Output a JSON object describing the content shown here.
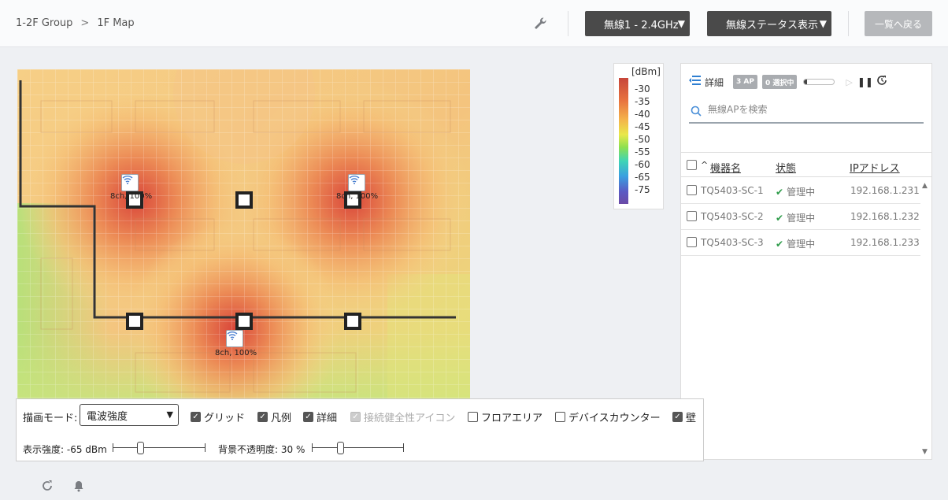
{
  "breadcrumb": {
    "group": "1-2F Group",
    "separator": ">",
    "current": "1F Map"
  },
  "header": {
    "band_select": "無線1 - 2.4GHz",
    "status_select": "無線ステータス表示",
    "back_button": "一覧へ戻る"
  },
  "map": {
    "access_points": [
      {
        "label": "8ch, 100%"
      },
      {
        "label": "8ch, 100%"
      },
      {
        "label": "8ch, 100%"
      }
    ]
  },
  "legend": {
    "unit": "[dBm]",
    "ticks": [
      "-30",
      "-35",
      "-40",
      "-45",
      "-50",
      "-55",
      "-60",
      "-65",
      "-75"
    ]
  },
  "panel": {
    "detail_label": "詳細",
    "ap_count_badge": "3 AP",
    "selected_badge": "0 選択中",
    "progress": 0.1,
    "search_placeholder": "無線APを検索",
    "columns": {
      "sort_indicator": "^",
      "name": "機器名",
      "status": "状態",
      "ip": "IPアドレス"
    },
    "rows": [
      {
        "name": "TQ5403-SC-1",
        "status": "管理中",
        "ip": "192.168.1.231"
      },
      {
        "name": "TQ5403-SC-2",
        "status": "管理中",
        "ip": "192.168.1.232"
      },
      {
        "name": "TQ5403-SC-3",
        "status": "管理中",
        "ip": "192.168.1.233"
      }
    ]
  },
  "controls": {
    "mode_label": "描画モード:",
    "mode_value": "電波強度",
    "grid": {
      "label": "グリッド",
      "checked": true
    },
    "legend_toggle": {
      "label": "凡例",
      "checked": true
    },
    "detail_toggle": {
      "label": "詳細",
      "checked": true
    },
    "health_icon": {
      "label": "接続健全性アイコン",
      "checked": true,
      "disabled": true
    },
    "floor_area": {
      "label": "フロアエリア",
      "checked": false
    },
    "device_counter": {
      "label": "デバイスカウンター",
      "checked": false
    },
    "wall": {
      "label": "壁",
      "checked": true
    },
    "strength_label": "表示強度: -65 dBm",
    "opacity_label": "背景不透明度: 30 %",
    "strength_value_dbm": -65,
    "opacity_value_pct": 30
  },
  "colors": {
    "dark_select": "#4a4a4a",
    "ok_check": "#2e9c4a",
    "heat_hot": "#d9563f",
    "heat_cool": "#a6e06a"
  },
  "icons": [
    "wrench-icon",
    "search-icon",
    "list-collapse-icon",
    "play-icon",
    "pause-icon",
    "refresh-icon",
    "wifi-icon",
    "bell-icon",
    "reload-icon"
  ]
}
